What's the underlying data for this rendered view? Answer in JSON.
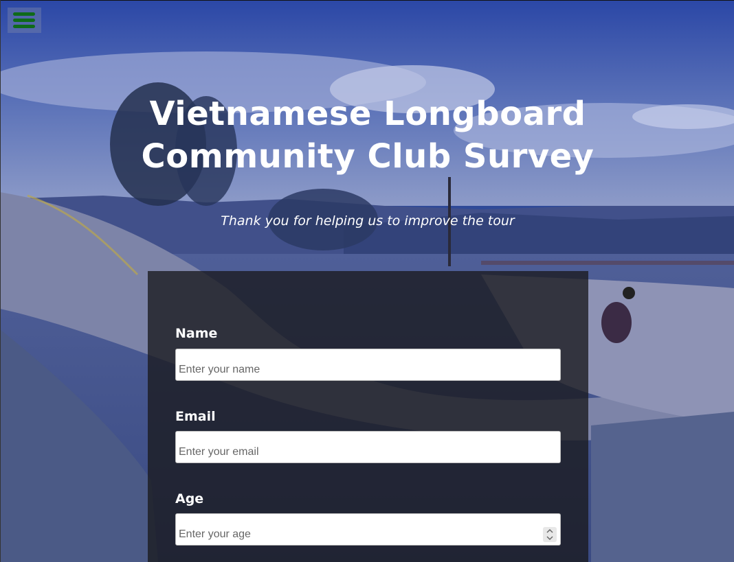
{
  "header": {
    "title": "Vietnamese Longboard Community Club Survey",
    "subtitle": "Thank you for helping us to improve the tour"
  },
  "menu": {
    "icon": "hamburger-menu-icon",
    "color": "#0f6a1a"
  },
  "form": {
    "fields": [
      {
        "label": "Name",
        "placeholder": "Enter your name",
        "type": "text"
      },
      {
        "label": "Email",
        "placeholder": "Enter your email",
        "type": "email"
      },
      {
        "label": "Age",
        "placeholder": "Enter your age",
        "type": "number"
      }
    ]
  },
  "colors": {
    "overlay": "#2f4a98",
    "panel": "#19191e",
    "text": "#ffffff"
  }
}
